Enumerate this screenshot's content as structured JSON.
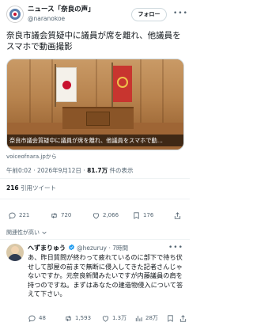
{
  "post": {
    "author_name": "ニュース「奈良の声」",
    "author_handle": "@naranokoe",
    "follow_label": "フォロー",
    "text": "奈良市議会質疑中に議員が席を離れ、他議員をスマホで動画撮影",
    "media_caption": "奈良市議会質疑中に議員が席を離れ、他議員をスマホで動…",
    "source": "voiceofnara.jpから",
    "time": "午前0:02",
    "date": "2026年9月12日",
    "views_count": "81.7万",
    "views_label": "件の表示"
  },
  "stats": {
    "reposts_count": "216",
    "reposts_label": "引用ツイート"
  },
  "actions": {
    "reply": "221",
    "repost": "720",
    "like": "2,066",
    "bookmark": "176"
  },
  "sort_label": "関連性が高い",
  "reply": {
    "author_name": "へずまりゅう",
    "verified": true,
    "handle": "@hezuruy",
    "time": "7時間",
    "text": "あ、昨日質問が終わって疲れているのに部下で待ち伏せして部屋の前まで無断に侵入してきた記者さんじゃないですか。元奈良新聞みたいですが内藤議員の肩を持つのですね。まずはあなたの建造物侵入について答えて下さい。",
    "actions": {
      "reply": "48",
      "repost": "1,593",
      "like": "1.3万",
      "views": "28万"
    }
  },
  "colors": {
    "icon_gray": "#536471",
    "verified_blue": "#1d9bf0"
  }
}
